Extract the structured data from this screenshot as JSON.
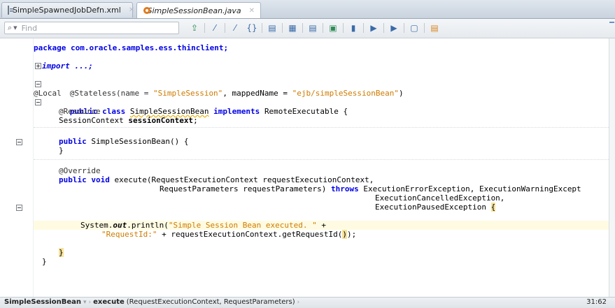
{
  "tabs": [
    {
      "label": "SimpleSpawnedJobDefn.xml",
      "active": false
    },
    {
      "label": "SimpleSessionBean.java",
      "active": true
    }
  ],
  "find": {
    "placeholder": "Find"
  },
  "toolbar_icons": [
    "toggle-bookmark-icon",
    "find-previous-icon",
    "find-next-icon",
    "bracket-match-icon",
    "toggle-comment-icon",
    "indent-icon",
    "unindent-icon",
    "compare-icon",
    "next-bookmark-icon",
    "previous-bookmark-icon",
    "clear-bookmarks-icon",
    "run-to-cursor-icon",
    "refactor-icon"
  ],
  "code": {
    "l1": "package com.oracle.samples.ess.thinclient;",
    "l2": "import ...;",
    "l3_a": "@Stateless(name = ",
    "l3_b": "\"SimpleSession\"",
    "l3_c": ", mappedName = ",
    "l3_d": "\"ejb/simpleSessionBean\"",
    "l3_e": ")",
    "l4": "@Local",
    "l5_kw": "public class",
    "l5_name": "SimpleSessionBean",
    "l5_kw2": "implements",
    "l5_rest": "RemoteExecutable {",
    "l6": "@Resource",
    "l7_a": "SessionContext ",
    "l7_b": "sessionContext",
    "l7_c": ";",
    "l8_kw": "public",
    "l8_rest": "SimpleSessionBean() {",
    "l9": "}",
    "l10": "@Override",
    "l11_kw": "public void",
    "l11_rest": "execute(RequestExecutionContext requestExecutionContext,",
    "l12_a": "RequestParameters requestParameters)",
    "l12_kw": "throws",
    "l12_b": "ExecutionErrorException, ExecutionWarningExcept",
    "l13": "ExecutionCancelledException,",
    "l14_a": "ExecutionPausedException ",
    "l14_b": "{",
    "l15_a": "System.",
    "l15_b": "out",
    "l15_c": ".println(",
    "l15_d": "\"Simple Session Bean executed. \"",
    "l15_e": " +",
    "l16_a": "\"RequestId:\"",
    "l16_b": " + requestExecutionContext.getRequestId(",
    "l16_c": ")",
    "l16_d": ");",
    "l17": "}",
    "l18": "}"
  },
  "status": {
    "class_crumb": "SimpleSessionBean",
    "method_name": "execute",
    "method_params": "(RequestExecutionContext, RequestParameters)",
    "position": "31:62"
  }
}
